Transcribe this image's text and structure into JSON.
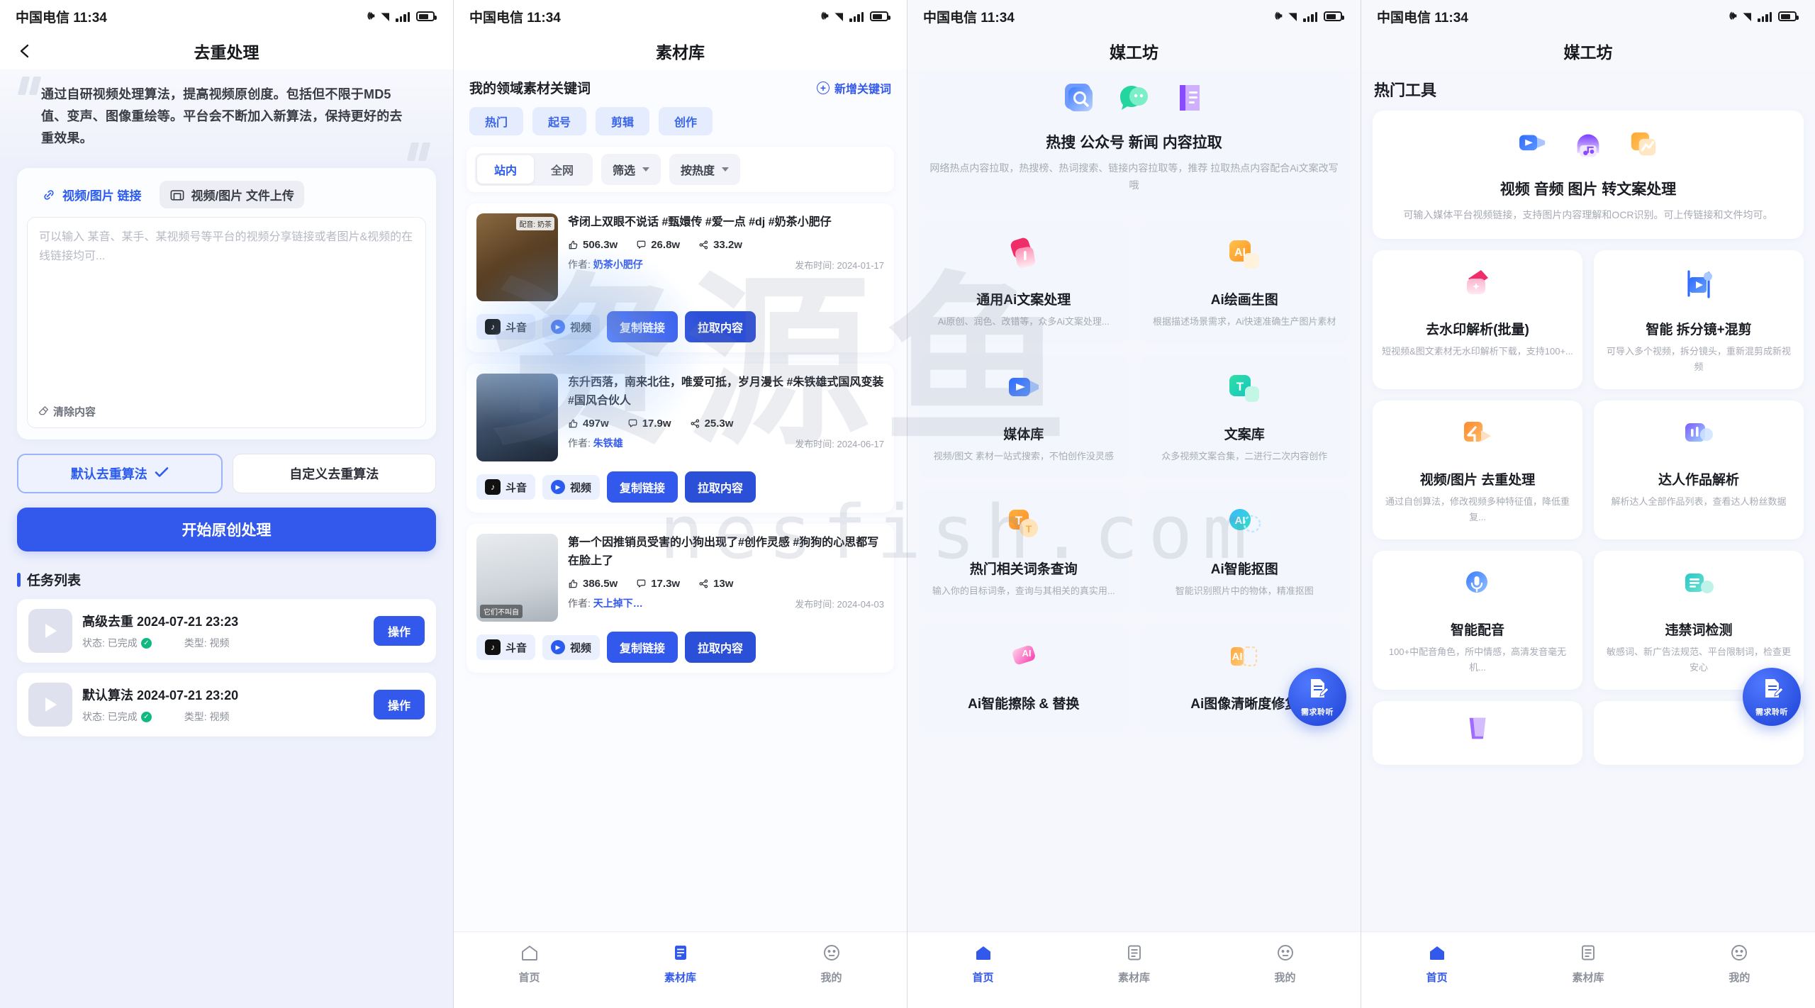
{
  "status_bar": {
    "carrier_time": "中国电信 11:34"
  },
  "watermark": {
    "big": "资源鱼",
    "sub": "nesfish.com"
  },
  "screen1": {
    "title": "去重处理",
    "back_icon": "chevron-left-icon",
    "quote": "通过自研视频处理算法，提高视频原创度。包括但不限于MD5值、变声、图像重绘等。平台会不断加入新算法，保持更好的去重效果。",
    "tabs": [
      {
        "label": "视频/图片 链接",
        "icon": "link-icon",
        "active": true
      },
      {
        "label": "视频/图片 文件上传",
        "icon": "folder-upload-icon",
        "active": false
      }
    ],
    "input_placeholder": "可以输入 某音、某手、某视频号等平台的视频分享链接或者图片&视频的在线链接均可...",
    "clear_label": "清除内容",
    "clear_icon": "eraser-icon",
    "algorithms": [
      {
        "label": "默认去重算法",
        "selected": true,
        "check_icon": "check-icon"
      },
      {
        "label": "自定义去重算法",
        "selected": false
      }
    ],
    "primary_button": "开始原创处理",
    "task_section_title": "任务列表",
    "tasks": [
      {
        "title": "高级去重 2024-07-21 23:23",
        "status_label": "状态: 已完成",
        "status_icon": "check-circle-icon",
        "type_label": "类型: 视频",
        "action": "操作"
      },
      {
        "title": "默认算法 2024-07-21 23:20",
        "status_label": "状态: 已完成",
        "status_icon": "check-circle-icon",
        "type_label": "类型: 视频",
        "action": "操作"
      }
    ]
  },
  "screen2": {
    "title": "素材库",
    "keyword_header": "我的领域素材关键词",
    "add_keyword": "新增关键词",
    "add_icon": "plus-circle-icon",
    "chips": [
      "热门",
      "起号",
      "剪辑",
      "创作"
    ],
    "segments": [
      {
        "label": "站内",
        "active": true
      },
      {
        "label": "全网",
        "active": false
      }
    ],
    "filters": [
      {
        "label": "筛选",
        "icon": "chevron-down-icon"
      },
      {
        "label": "按热度",
        "icon": "chevron-down-icon"
      }
    ],
    "videos": [
      {
        "title": "爷闭上双眼不说话 #甄嬛传 #爱一点 #dj #奶茶小肥仔",
        "likes": "506.3w",
        "comments": "26.8w",
        "shares": "33.2w",
        "author_label": "作者:",
        "author": "奶茶小肥仔",
        "publish": "发布时间: 2024-01-17",
        "platform": "斗音",
        "media_type": "视频",
        "thumb_tag": "配音: 奶茶",
        "copy_button": "复制链接",
        "pull_button": "拉取内容",
        "thumb_color_a": "#6b4a2c",
        "thumb_color_b": "#c9a06a"
      },
      {
        "title": "东升西落，南来北往，唯爱可抵，岁月漫长 #朱铁雄式国风变装 #国风合伙人",
        "likes": "497w",
        "comments": "17.9w",
        "shares": "25.3w",
        "author_label": "作者:",
        "author": "朱铁雄",
        "publish": "发布时间: 2024-06-17",
        "platform": "斗音",
        "media_type": "视频",
        "thumb_tag": "",
        "copy_button": "复制链接",
        "pull_button": "拉取内容",
        "thumb_color_a": "#2c3b52",
        "thumb_color_b": "#7a8fa8"
      },
      {
        "title": "第一个因推销员受害的小狗出现了#创作灵感 #狗狗的心思都写在脸上了",
        "likes": "386.5w",
        "comments": "17.3w",
        "shares": "13w",
        "author_label": "作者:",
        "author": "天上掉下…",
        "publish": "发布时间: 2024-04-03",
        "platform": "斗音",
        "media_type": "视频",
        "thumb_tag": "",
        "btag": "它们不叫自",
        "copy_button": "复制链接",
        "pull_button": "拉取内容",
        "thumb_color_a": "#cfd4da",
        "thumb_color_b": "#f2f4f6"
      }
    ],
    "tabbar": [
      {
        "label": "首页",
        "icon": "home-icon",
        "active": false
      },
      {
        "label": "素材库",
        "icon": "library-icon",
        "active": true
      },
      {
        "label": "我的",
        "icon": "profile-icon",
        "active": false
      }
    ]
  },
  "screen3": {
    "title": "媒工坊",
    "hero": {
      "title": "热搜 公众号 新闻 内容拉取",
      "desc": "网络热点内容拉取，热搜榜、热词搜索、链接内容拉取等，推荐 拉取热点内容配合Ai文案改写哦",
      "icons": [
        "search-card-icon",
        "wechat-bubble-icon",
        "news-doc-icon"
      ]
    },
    "tiles": [
      {
        "title": "通用Ai文案处理",
        "desc": "Ai原创、润色、改错等，众多Ai文案处理...",
        "icon": "pink-pen-icon"
      },
      {
        "title": "Ai绘画生图",
        "desc": "根据描述场景需求，Ai快速准确生产图片素材",
        "icon": "ai-orange-icon"
      },
      {
        "title": "媒体库",
        "desc": "视频/图文 素材一站式搜索，不怕创作没灵感",
        "icon": "video-blue-icon"
      },
      {
        "title": "文案库",
        "desc": "众多视频文案合集，二进行二次内容创作",
        "icon": "text-green-icon"
      },
      {
        "title": "热门相关词条查询",
        "desc": "输入你的目标词条，查询与其相关的真实用...",
        "icon": "tt-orange-icon"
      },
      {
        "title": "Ai智能抠图",
        "desc": "智能识别照片中的物体，精准抠图",
        "icon": "ai-cyan-icon"
      },
      {
        "title": "Ai智能擦除 & 替换",
        "desc": "",
        "icon": "ai-pink-eraser-icon"
      },
      {
        "title": "Ai图像清晰度修复",
        "desc": "",
        "icon": "ai-amber-icon"
      }
    ],
    "fab_label": "需求聆听",
    "fab_icon": "document-edit-icon",
    "tabbar": [
      {
        "label": "首页",
        "icon": "home-icon",
        "active": true
      },
      {
        "label": "素材库",
        "icon": "library-icon",
        "active": false
      },
      {
        "label": "我的",
        "icon": "profile-icon",
        "active": false
      }
    ]
  },
  "screen4": {
    "title": "媒工坊",
    "section_title": "热门工具",
    "hero": {
      "title": "视频 音频 图片 转文案处理",
      "desc": "可输入媒体平台视频链接，支持图片内容理解和OCR识别。可上传链接和文件均可。",
      "icons": [
        "video-blue-icon",
        "audio-purple-icon",
        "image-orange-icon"
      ]
    },
    "tiles": [
      {
        "title": "去水印解析(批量)",
        "desc": "短视频&图文素材无水印解析下载，支持100+...",
        "icon": "pink-watermark-icon"
      },
      {
        "title": "智能 拆分镜+混剪",
        "desc": "可导入多个视频，拆分镜头，重新混剪成新视频",
        "icon": "blue-split-icon"
      },
      {
        "title": "视频/图片 去重处理",
        "desc": "通过自创算法，修改视频多种特征值，降低重复...",
        "icon": "orange-dedupe-icon"
      },
      {
        "title": "达人作品解析",
        "desc": "解析达人全部作品列表，查看达人粉丝数据",
        "icon": "purple-analytics-icon"
      },
      {
        "title": "智能配音",
        "desc": "100+中配音角色，所中情感，高清发音毫无机...",
        "icon": "blue-voice-icon"
      },
      {
        "title": "违禁词检测",
        "desc": "敏感词、新广告法规范、平台限制词，检查更安心",
        "icon": "cyan-text-icon"
      }
    ],
    "fab_label": "需求聆听",
    "fab_icon": "document-edit-icon",
    "tabbar": [
      {
        "label": "首页",
        "icon": "home-icon",
        "active": true
      },
      {
        "label": "素材库",
        "icon": "library-icon",
        "active": false
      },
      {
        "label": "我的",
        "icon": "profile-icon",
        "active": false
      }
    ]
  },
  "colors": {
    "accent": "#3358ec",
    "accent_light": "#2b5bef",
    "success": "#10b981",
    "muted": "#a7abb5"
  }
}
